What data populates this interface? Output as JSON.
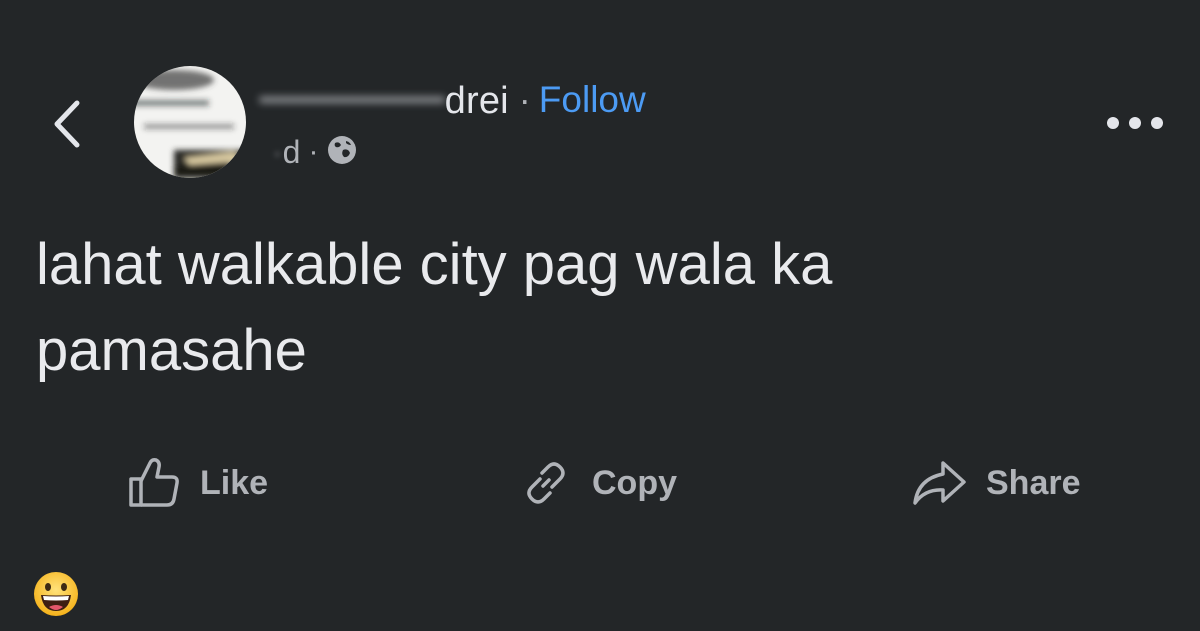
{
  "header": {
    "author_name_visible": "drei",
    "separator": "·",
    "follow_label": "Follow",
    "timestamp": "d",
    "meta_separator": "·",
    "privacy_icon": "globe-icon",
    "back_icon": "chevron-left-icon",
    "more_icon": "more-horizontal-icon"
  },
  "post": {
    "line1": "lahat walkable city pag wala ka",
    "line2": "pamasahe"
  },
  "actions": {
    "like_label": "Like",
    "copy_label": "Copy",
    "share_label": "Share",
    "like_icon": "thumbs-up-icon",
    "copy_icon": "link-icon",
    "share_icon": "share-arrow-icon"
  },
  "reaction": {
    "icon": "grinning-face-emoji"
  },
  "colors": {
    "background": "#232628",
    "text_primary": "#e4e6eb",
    "text_secondary": "#b0b3b8",
    "follow_blue": "#4c9bf4"
  }
}
